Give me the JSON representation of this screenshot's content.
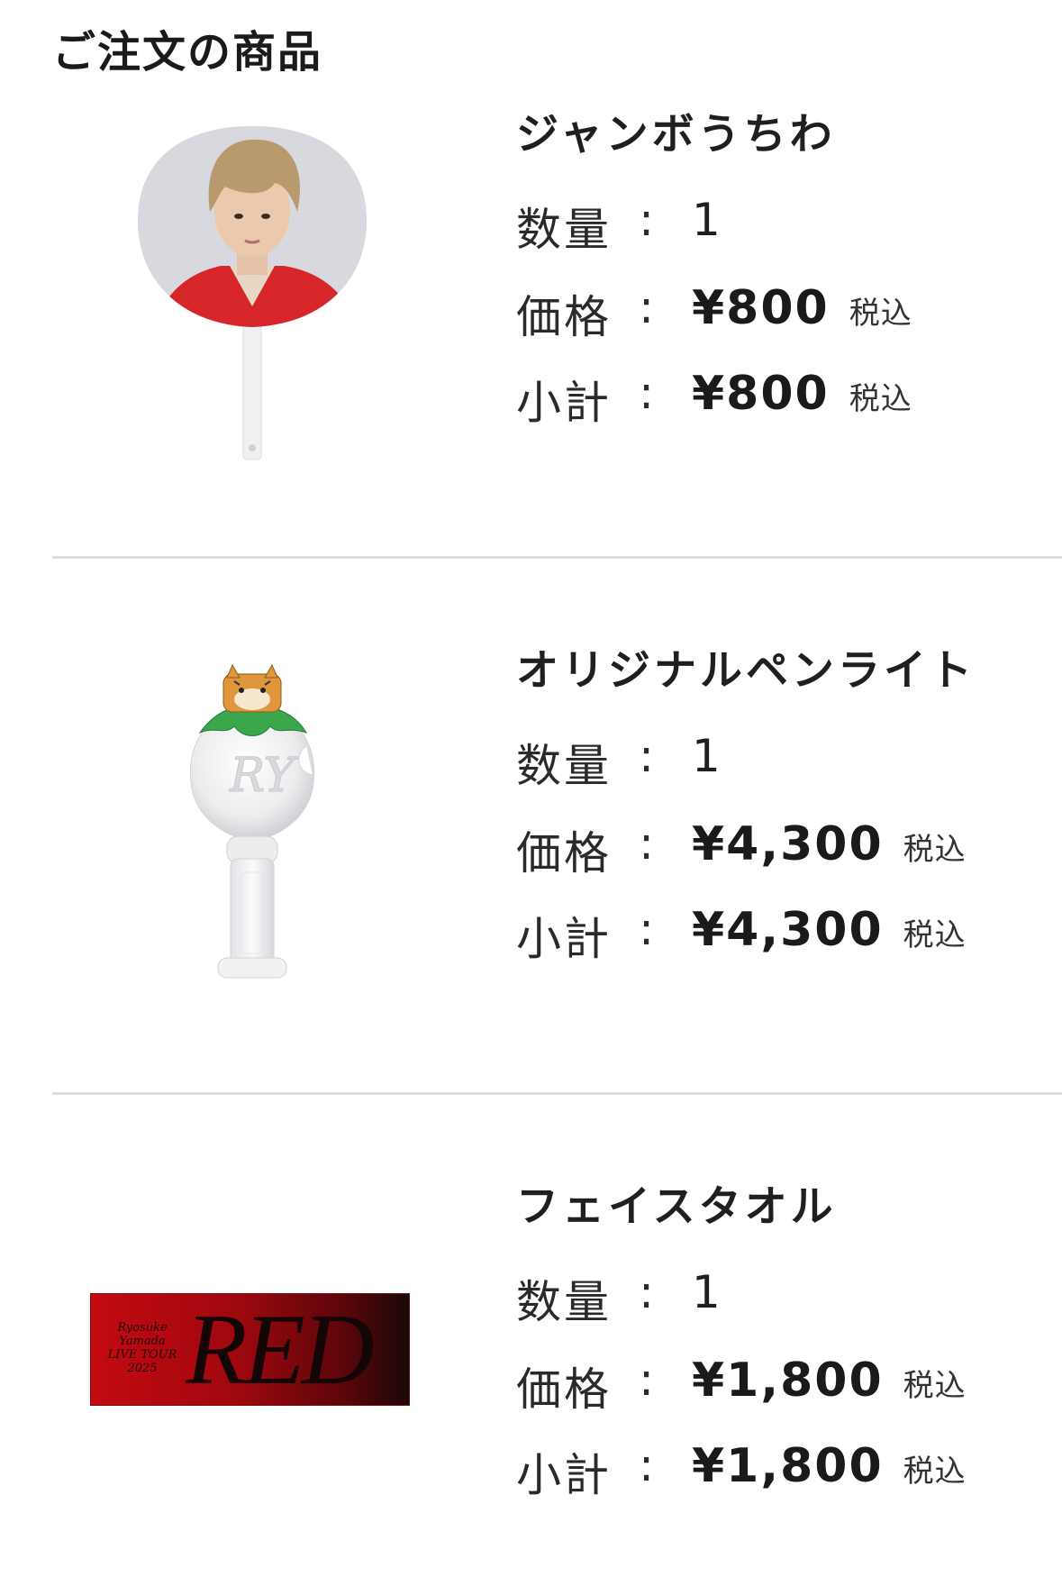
{
  "page": {
    "title": "ご注文の商品"
  },
  "labels": {
    "quantity": "数量",
    "price": "価格",
    "subtotal": "小計",
    "colon": ":",
    "tax_included": "税込"
  },
  "items": [
    {
      "name": "ジャンボうちわ",
      "quantity": "1",
      "price": "¥800",
      "subtotal": "¥800",
      "image": "uchiwa-fan-image"
    },
    {
      "name": "オリジナルペンライト",
      "quantity": "1",
      "price": "¥4,300",
      "subtotal": "¥4,300",
      "image": "penlight-image"
    },
    {
      "name": "フェイスタオル",
      "quantity": "1",
      "price": "¥1,800",
      "subtotal": "¥1,800",
      "image": "face-towel-image",
      "image_text": {
        "line1": "Ryosuke",
        "line2": "Yamada",
        "line3": "LIVE TOUR",
        "line4": "2025",
        "big": "RED"
      }
    }
  ],
  "colors": {
    "divider": "#dcdcdc",
    "towel_red": "#c40a12",
    "text": "#1f1f1f"
  }
}
